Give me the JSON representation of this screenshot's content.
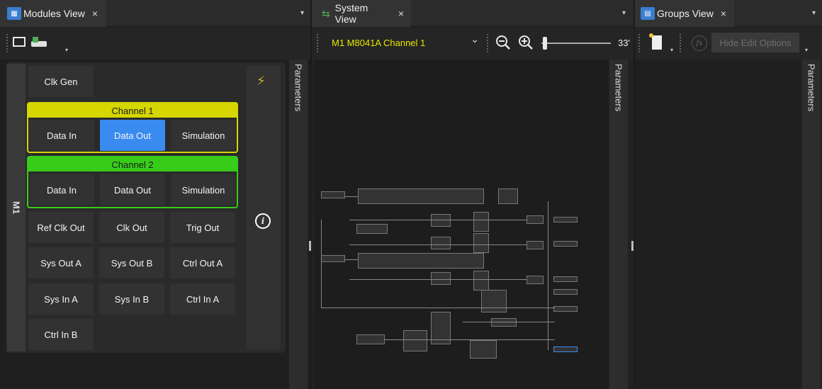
{
  "modules_view": {
    "tab_label": "Modules View",
    "tab_close": "×",
    "dropdown": "▾",
    "sidebar_label": "M1",
    "clk_gen": "Clk Gen",
    "channel1": {
      "header": "Channel 1",
      "buttons": [
        "Data In",
        "Data Out",
        "Simulation"
      ],
      "color": "#d6d600"
    },
    "channel2": {
      "header": "Channel 2",
      "buttons": [
        "Data In",
        "Data Out",
        "Simulation"
      ],
      "color": "#38cc1a"
    },
    "selected_color": "#3a8bf0",
    "grid_rows": [
      [
        "Ref Clk Out",
        "Clk Out",
        "Trig Out"
      ],
      [
        "Sys Out A",
        "Sys Out B",
        "Ctrl Out A"
      ],
      [
        "Sys In A",
        "Sys In B",
        "Ctrl In A"
      ],
      [
        "Ctrl In B"
      ]
    ],
    "info_icon": "i",
    "parameters": "Parameters"
  },
  "system_view": {
    "tab_label": "System View",
    "tab_close": "×",
    "dropdown": "▾",
    "selector_value": "M1 M8041A Channel 1",
    "selector_chevron": "⌄",
    "zoom_value": "33'",
    "parameters": "Parameters"
  },
  "groups_view": {
    "tab_label": "Groups View",
    "tab_close": "×",
    "dropdown": "▾",
    "fx_label": "fx",
    "hide_edit": "Hide Edit Options",
    "parameters": "Parameters"
  }
}
